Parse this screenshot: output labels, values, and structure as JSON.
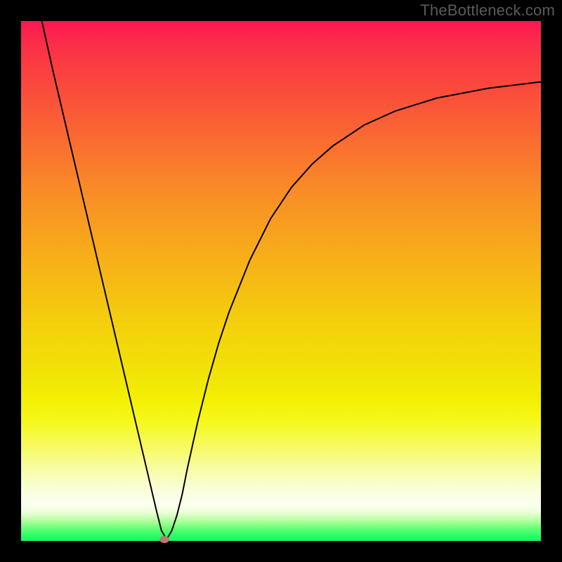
{
  "watermark": "TheBottleneck.com",
  "colors": {
    "curve_stroke": "#000000",
    "marker_fill": "#c6736e",
    "frame_bg": "#000000"
  },
  "chart_data": {
    "type": "line",
    "title": "",
    "xlabel": "",
    "ylabel": "",
    "xlim": [
      0,
      100
    ],
    "ylim": [
      0,
      100
    ],
    "grid": false,
    "legend": false,
    "series": [
      {
        "name": "curve",
        "x": [
          4,
          6,
          8,
          10,
          12,
          14,
          16,
          18,
          20,
          22,
          24,
          26,
          27,
          28,
          29,
          30,
          31,
          32,
          34,
          36,
          38,
          40,
          44,
          48,
          52,
          56,
          60,
          66,
          72,
          80,
          90,
          100
        ],
        "y": [
          100,
          91,
          82.5,
          74,
          65.5,
          57,
          48.5,
          40,
          31.5,
          23,
          14.5,
          6,
          2,
          0.3,
          2,
          5,
          9,
          14,
          23,
          31,
          38,
          44,
          54,
          62,
          68,
          72.5,
          76,
          80,
          82.7,
          85.2,
          87.1,
          88.3
        ]
      }
    ],
    "marker": {
      "x": 27.5,
      "y": 0.3
    },
    "gradient_stops": [
      {
        "pos": 0.0,
        "color": "#fc1852"
      },
      {
        "pos": 0.06,
        "color": "#fb3444"
      },
      {
        "pos": 0.18,
        "color": "#fa5b36"
      },
      {
        "pos": 0.32,
        "color": "#f98a27"
      },
      {
        "pos": 0.46,
        "color": "#f7b018"
      },
      {
        "pos": 0.58,
        "color": "#f4cf0d"
      },
      {
        "pos": 0.68,
        "color": "#f2e306"
      },
      {
        "pos": 0.73,
        "color": "#f3f004"
      },
      {
        "pos": 0.77,
        "color": "#f6f81c"
      },
      {
        "pos": 0.82,
        "color": "#f7fa63"
      },
      {
        "pos": 0.86,
        "color": "#f8fca3"
      },
      {
        "pos": 0.9,
        "color": "#f9fed8"
      },
      {
        "pos": 0.93,
        "color": "#fbfff0"
      },
      {
        "pos": 0.945,
        "color": "#ecffd8"
      },
      {
        "pos": 0.96,
        "color": "#b6ffa1"
      },
      {
        "pos": 0.975,
        "color": "#6cff78"
      },
      {
        "pos": 0.99,
        "color": "#29fd66"
      },
      {
        "pos": 1.0,
        "color": "#17f765"
      }
    ]
  }
}
